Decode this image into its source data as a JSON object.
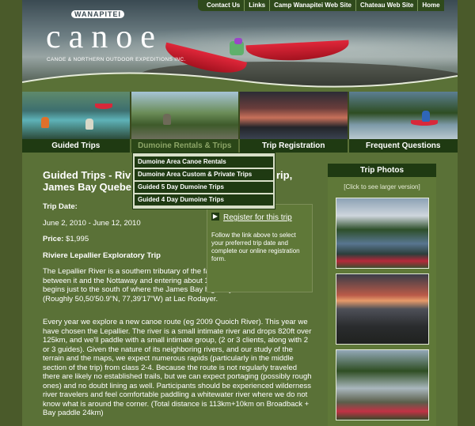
{
  "topnav": [
    "Contact Us",
    "Links",
    "Camp Wanapitei Web Site",
    "Chateau Web Site",
    "Home"
  ],
  "brand": {
    "top": "WANAPITEI",
    "name": "canoe",
    "sub": "CANOE & NORTHERN OUTDOOR EXPEDITIONS INC."
  },
  "tabs": [
    "Guided Trips",
    "Dumoine Rentals & Trips",
    "Trip Registration",
    "Frequent Questions"
  ],
  "dropdown": [
    "Dumoine Area Canoe Rentals",
    "Dumoine Area Custom & Private Trips",
    "Guided 5 Day Dumoine Trips",
    "Guided 4 Day Dumoine Trips"
  ],
  "content": {
    "title_left": "Guided Trips - Riv",
    "title_right": "rip,",
    "title_line2": "James Bay Quebe",
    "trip_date_label": "Trip Date:",
    "trip_date": "June 2, 2010 - June 12, 2010",
    "price_label": "Price:",
    "price": "$1,995",
    "trip_name": "Riviere Lepallier Exploratory Trip",
    "para1": "The Lepallier River is a southern tributary of the famous Broadback River flowing between it and the Nottaway and entering about 10km above James Bay. It begins just to the south of where the James Bay highway crosses the Broadback. (Roughly 50,50'50.9\"N, 77,39'17\"W)  at Lac Rodayer.",
    "para2": "Every year we explore a new canoe route (eg 2009 Quoich River).  This year we have chosen the Lepallier.  The river is a small intimate river and drops 820ft over 125km, and we'll paddle with a small intimate group, (2 or 3 clients, along with 2 or 3 guides).  Given the nature of its neighboring rivers, and our study of the terrain and the maps, we expect numerous rapids (particularly in the middle section of the trip) from class 2-4.  Because the route is not regularly traveled there are likely no established trails, but we can expect portaging (possibly rough ones) and no doubt lining as well.  Participants should be experienced wilderness river travelers and feel comfortable paddling a whitewater river where we do not know what is around the corner.  (Total distance is 113km+10km on Broadback + Bay paddle 24km)"
  },
  "register": {
    "link": "Register for this trip",
    "text": "Follow the link above to select your preferred trip date and complete our online registration form."
  },
  "sidebar": {
    "title": "Trip Photos",
    "note": "[Click to see larger version]"
  }
}
